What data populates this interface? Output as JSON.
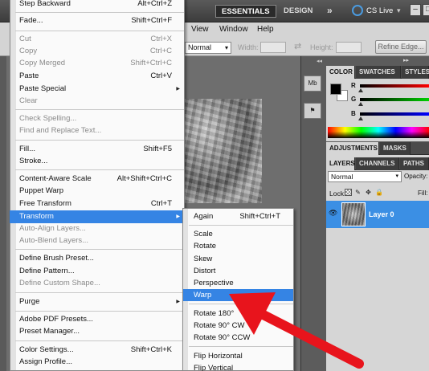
{
  "topbar": {
    "workspace_active": "ESSENTIALS",
    "workspace_other": "DESIGN",
    "workspace_more": "»",
    "cs_live": "CS Live",
    "cs_live_chev": "▾",
    "minimize": "–",
    "maximize": "□"
  },
  "menubar": {
    "view": "View",
    "window": "Window",
    "help": "Help"
  },
  "options": {
    "mode": "Normal",
    "width_label": "Width:",
    "width_value": "",
    "swap": "⇄",
    "height_label": "Height:",
    "height_value": "",
    "refine_edge": "Refine Edge..."
  },
  "mini_panels": {
    "grip": "◂◂",
    "histogram": "Mb",
    "history": "⚑"
  },
  "color_panel": {
    "tabs": [
      "COLOR",
      "SWATCHES",
      "STYLES"
    ],
    "collapse": "▸▸",
    "fg_color": "#000000",
    "bg_color": "#ffffff",
    "channels": [
      "R",
      "G",
      "B"
    ]
  },
  "adjust_panel": {
    "tabs": [
      "ADJUSTMENTS",
      "MASKS"
    ]
  },
  "layers_panel": {
    "tabs": [
      "LAYERS",
      "CHANNELS",
      "PATHS"
    ],
    "blend_mode": "Normal",
    "opacity_label": "Opacity:",
    "lock_label": "Lock:",
    "fill_label": "Fill:",
    "layer_name": "Layer 0"
  },
  "edit_menu": {
    "items": [
      {
        "label": "Step Backward",
        "shortcut": "Alt+Ctrl+Z",
        "disabled": false
      },
      {
        "label": "Fade...",
        "shortcut": "Shift+Ctrl+F",
        "disabled": false
      },
      {
        "label": "Cut",
        "shortcut": "Ctrl+X",
        "disabled": true
      },
      {
        "label": "Copy",
        "shortcut": "Ctrl+C",
        "disabled": true
      },
      {
        "label": "Copy Merged",
        "shortcut": "Shift+Ctrl+C",
        "disabled": true
      },
      {
        "label": "Paste",
        "shortcut": "Ctrl+V",
        "disabled": false
      },
      {
        "label": "Paste Special",
        "shortcut": "",
        "disabled": false
      },
      {
        "label": "Clear",
        "shortcut": "",
        "disabled": true
      },
      {
        "label": "Check Spelling...",
        "shortcut": "",
        "disabled": true
      },
      {
        "label": "Find and Replace Text...",
        "shortcut": "",
        "disabled": true
      },
      {
        "label": "Fill...",
        "shortcut": "Shift+F5",
        "disabled": false
      },
      {
        "label": "Stroke...",
        "shortcut": "",
        "disabled": false
      },
      {
        "label": "Content-Aware Scale",
        "shortcut": "Alt+Shift+Ctrl+C",
        "disabled": false
      },
      {
        "label": "Puppet Warp",
        "shortcut": "",
        "disabled": false
      },
      {
        "label": "Free Transform",
        "shortcut": "Ctrl+T",
        "disabled": false
      },
      {
        "label": "Transform",
        "shortcut": "",
        "disabled": false
      },
      {
        "label": "Auto-Align Layers...",
        "shortcut": "",
        "disabled": true
      },
      {
        "label": "Auto-Blend Layers...",
        "shortcut": "",
        "disabled": true
      },
      {
        "label": "Define Brush Preset...",
        "shortcut": "",
        "disabled": false
      },
      {
        "label": "Define Pattern...",
        "shortcut": "",
        "disabled": false
      },
      {
        "label": "Define Custom Shape...",
        "shortcut": "",
        "disabled": true
      },
      {
        "label": "Purge",
        "shortcut": "",
        "disabled": false
      },
      {
        "label": "Adobe PDF Presets...",
        "shortcut": "",
        "disabled": false
      },
      {
        "label": "Preset Manager...",
        "shortcut": "",
        "disabled": false
      },
      {
        "label": "Color Settings...",
        "shortcut": "Shift+Ctrl+K",
        "disabled": false
      },
      {
        "label": "Assign Profile...",
        "shortcut": "",
        "disabled": false
      }
    ],
    "submenu_arrow": "▶"
  },
  "transform_submenu": {
    "items": [
      {
        "label": "Again",
        "shortcut": "Shift+Ctrl+T"
      },
      {
        "label": "Scale",
        "shortcut": ""
      },
      {
        "label": "Rotate",
        "shortcut": ""
      },
      {
        "label": "Skew",
        "shortcut": ""
      },
      {
        "label": "Distort",
        "shortcut": ""
      },
      {
        "label": "Perspective",
        "shortcut": ""
      },
      {
        "label": "Warp",
        "shortcut": ""
      },
      {
        "label": "Rotate 180°",
        "shortcut": ""
      },
      {
        "label": "Rotate 90° CW",
        "shortcut": ""
      },
      {
        "label": "Rotate 90° CCW",
        "shortcut": ""
      },
      {
        "label": "Flip Horizontal",
        "shortcut": ""
      },
      {
        "label": "Flip Vertical",
        "shortcut": ""
      }
    ]
  },
  "annotation": {
    "arrow_color": "#e8141c"
  }
}
